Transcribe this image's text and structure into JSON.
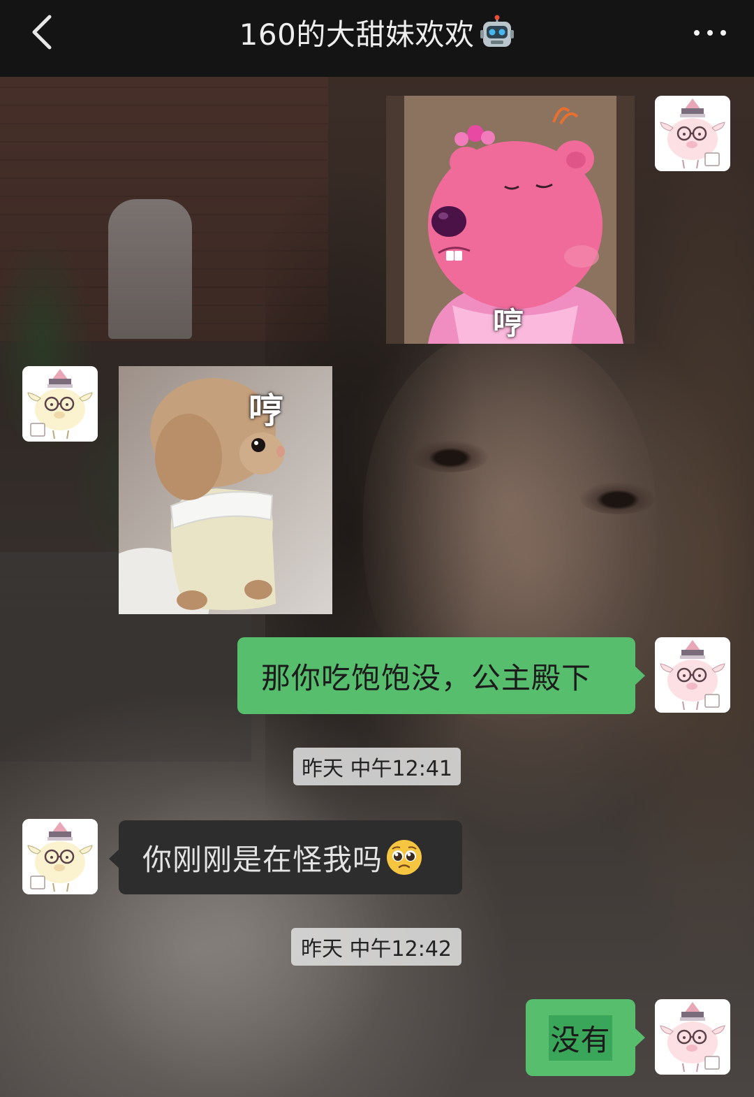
{
  "header": {
    "title": "160的大甜妹欢欢",
    "title_icon": "robot-icon",
    "back_icon": "chevron-left-icon",
    "more_icon": "more-horizontal-icon"
  },
  "messages": [
    {
      "type": "sticker",
      "from": "me",
      "sticker": "pink-beaver-sticker",
      "caption": "哼"
    },
    {
      "type": "sticker",
      "from": "them",
      "sticker": "plush-puppy-sticker",
      "caption": "哼"
    },
    {
      "type": "text",
      "from": "me",
      "text": "那你吃饱饱没，公主殿下"
    },
    {
      "type": "time",
      "text": "昨天 中午12:41"
    },
    {
      "type": "text",
      "from": "them",
      "text": "你刚刚是在怪我吗",
      "emoji": "pleading-face-emoji"
    },
    {
      "type": "time",
      "text": "昨天 中午12:42"
    },
    {
      "type": "text",
      "from": "me",
      "text": "没有"
    }
  ],
  "colors": {
    "topbar": "#141414",
    "my_bubble": "#57be6e",
    "their_bubble": "#2d2d2d",
    "timestamp_bg": "#dedede"
  }
}
